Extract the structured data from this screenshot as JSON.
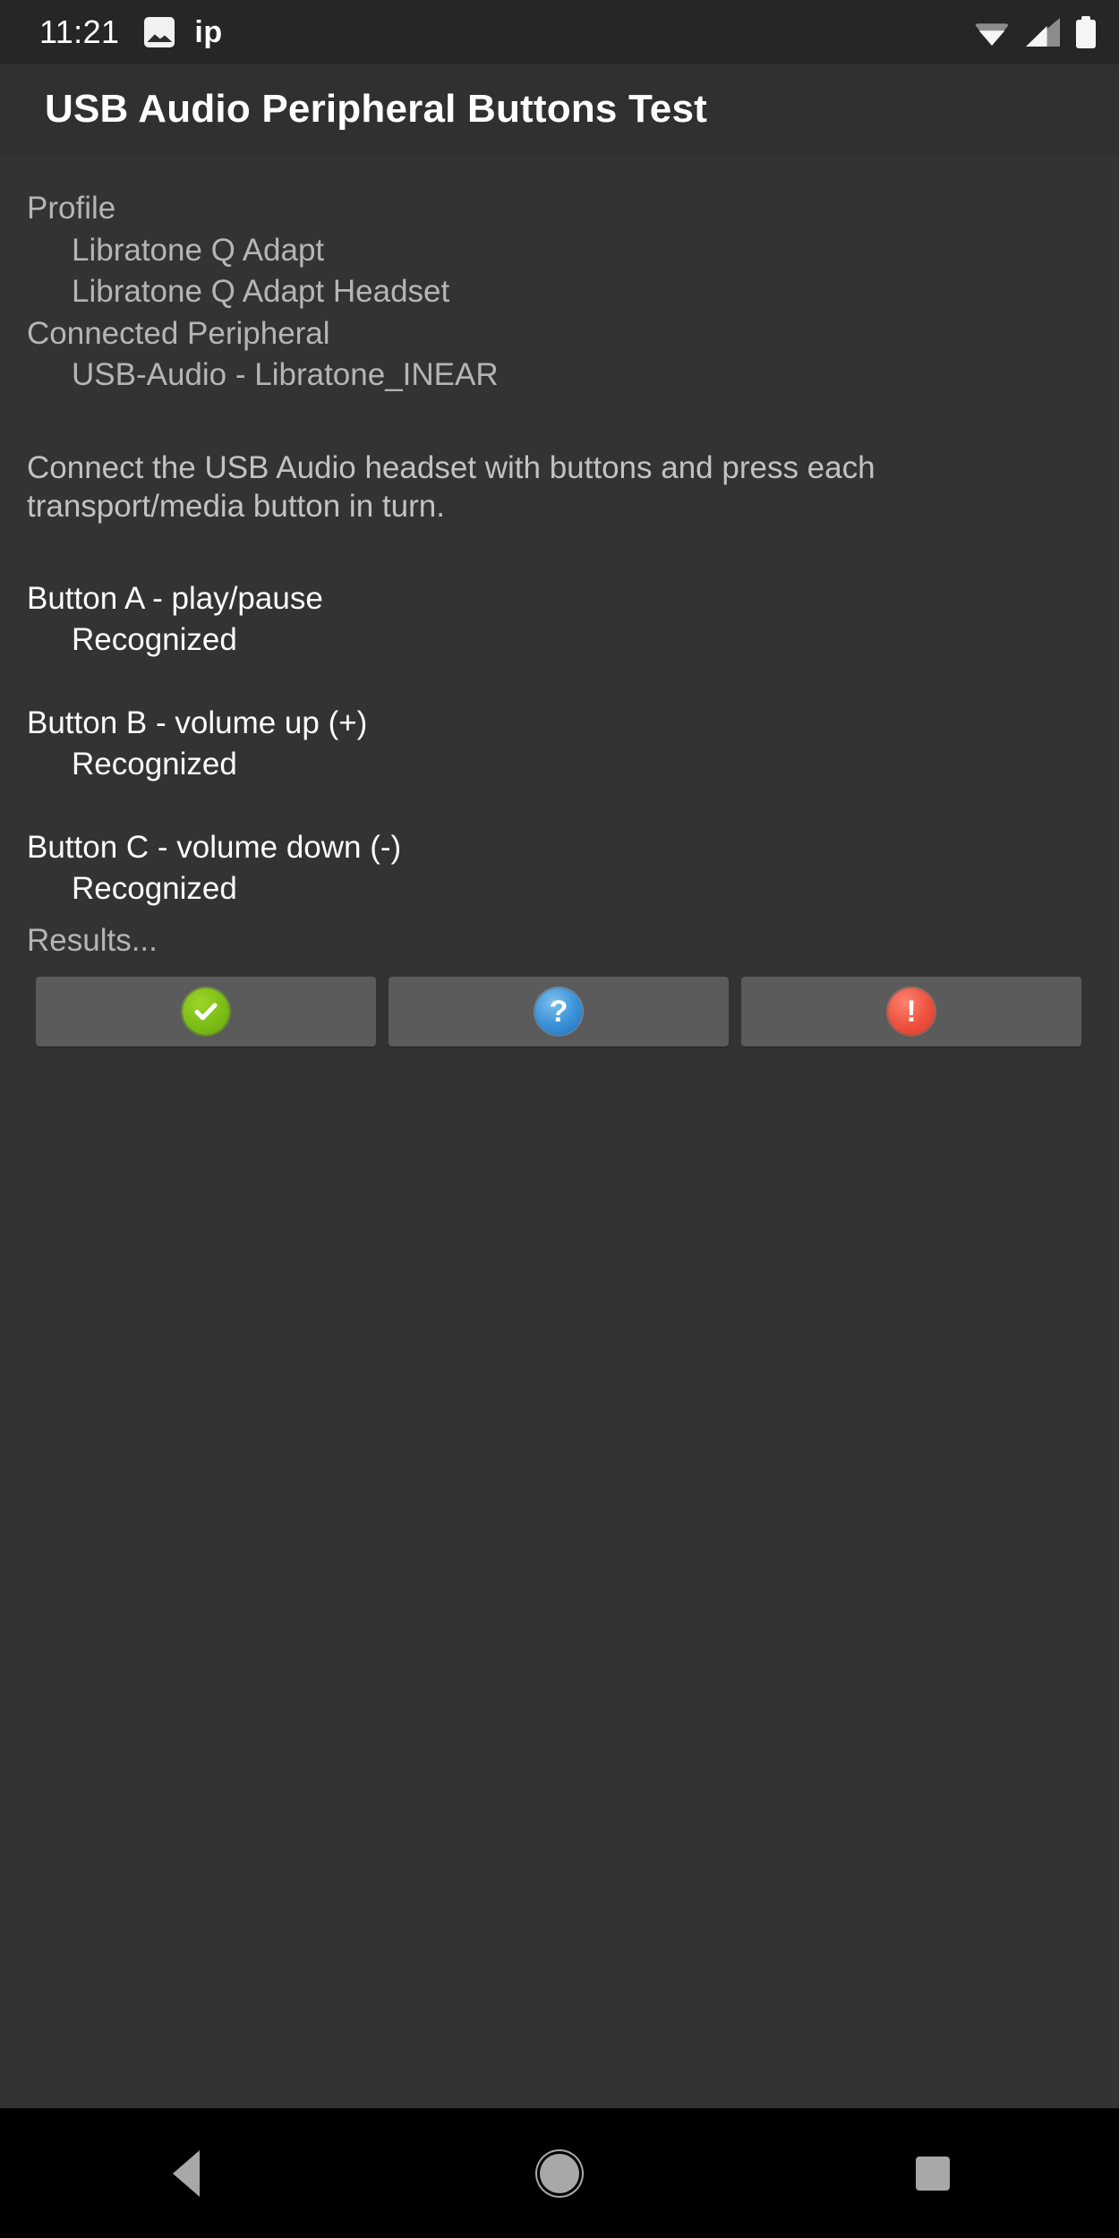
{
  "status_bar": {
    "clock": "11:21",
    "notification_label": "ip",
    "icons": [
      "photo-icon",
      "wifi-icon",
      "signal-icon",
      "battery-icon"
    ]
  },
  "app_bar": {
    "title": "USB Audio Peripheral Buttons Test"
  },
  "content": {
    "profile_heading": "Profile",
    "profile_values": [
      "Libratone Q Adapt",
      "Libratone Q Adapt Headset"
    ],
    "peripheral_heading": "Connected Peripheral",
    "peripheral_value": "USB-Audio - Libratone_INEAR",
    "instructions": "Connect the USB Audio headset with buttons and press each transport/media button in turn.",
    "button_tests": [
      {
        "label": "Button A - play/pause",
        "status": "Recognized"
      },
      {
        "label": "Button B - volume up (+)",
        "status": "Recognized"
      },
      {
        "label": "Button C - volume down (-)",
        "status": "Recognized"
      }
    ],
    "results_label": "Results..."
  },
  "result_buttons": [
    {
      "name": "pass-button",
      "glyph": "✔",
      "color": "#7cbd17",
      "semantic": "pass"
    },
    {
      "name": "info-button",
      "glyph": "?",
      "color": "#3d94d9",
      "semantic": "info"
    },
    {
      "name": "fail-button",
      "glyph": "!",
      "color": "#ef5340",
      "semantic": "fail"
    }
  ],
  "nav_bar": {
    "back_label": "Back",
    "home_label": "Home",
    "recents_label": "Recent apps"
  },
  "colors": {
    "status_bar_bg": "#262626",
    "app_bar_bg": "#303030",
    "content_bg": "#333333",
    "nav_bar_bg": "#000000",
    "button_bg": "#5b5b5b",
    "primary_text": "#fdfdfd",
    "secondary_text": "#b5b5b5"
  }
}
